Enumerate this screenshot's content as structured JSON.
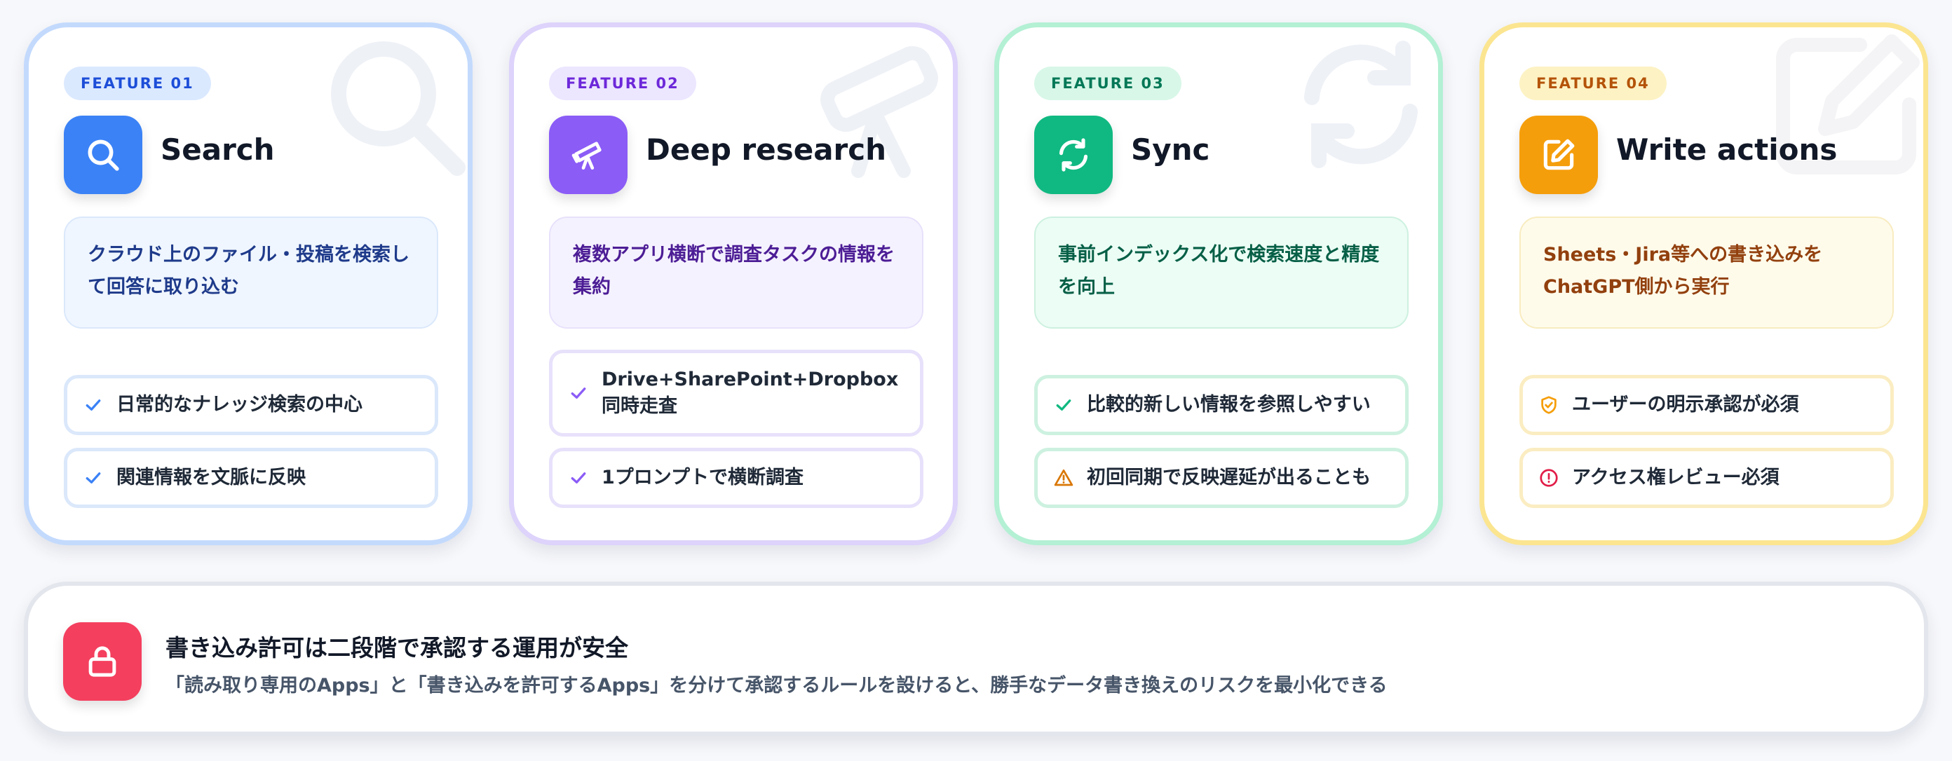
{
  "features": [
    {
      "badge": "FEATURE 01",
      "title": "Search",
      "icon": "search-icon",
      "accent": "#3b82f6",
      "description": "クラウド上のファイル・投稿を検索して回答に取り込む",
      "points": [
        {
          "icon": "check-icon",
          "text": "日常的なナレッジ検索の中心"
        },
        {
          "icon": "check-icon",
          "text": "関連情報を文脈に反映"
        }
      ]
    },
    {
      "badge": "FEATURE 02",
      "title": "Deep research",
      "icon": "telescope-icon",
      "accent": "#8b5cf6",
      "description": "複数アプリ横断で調査タスクの情報を集約",
      "points": [
        {
          "icon": "check-icon",
          "text": "Drive+SharePoint+Dropbox同時走査"
        },
        {
          "icon": "check-icon",
          "text": "1プロンプトで横断調査"
        }
      ]
    },
    {
      "badge": "FEATURE 03",
      "title": "Sync",
      "icon": "sync-icon",
      "accent": "#10b981",
      "description": "事前インデックス化で検索速度と精度を向上",
      "points": [
        {
          "icon": "check-icon",
          "text": "比較的新しい情報を参照しやすい"
        },
        {
          "icon": "warning-icon",
          "text": "初回同期で反映遅延が出ることも"
        }
      ]
    },
    {
      "badge": "FEATURE 04",
      "title": "Write actions",
      "icon": "edit-icon",
      "accent": "#f59e0b",
      "description": "Sheets・Jira等への書き込みをChatGPT側から実行",
      "points": [
        {
          "icon": "shield-check-icon",
          "text": "ユーザーの明示承認が必須"
        },
        {
          "icon": "alert-circle-icon",
          "text": "アクセス権レビュー必須"
        }
      ]
    }
  ],
  "banner": {
    "icon": "lock-icon",
    "accent": "#f43f5e",
    "title": "書き込み許可は二段階で承認する運用が安全",
    "text": "「読み取り専用のApps」と「書き込みを許可するApps」を分けて承認するルールを設けると、勝手なデータ書き換えのリスクを最小化できる"
  }
}
